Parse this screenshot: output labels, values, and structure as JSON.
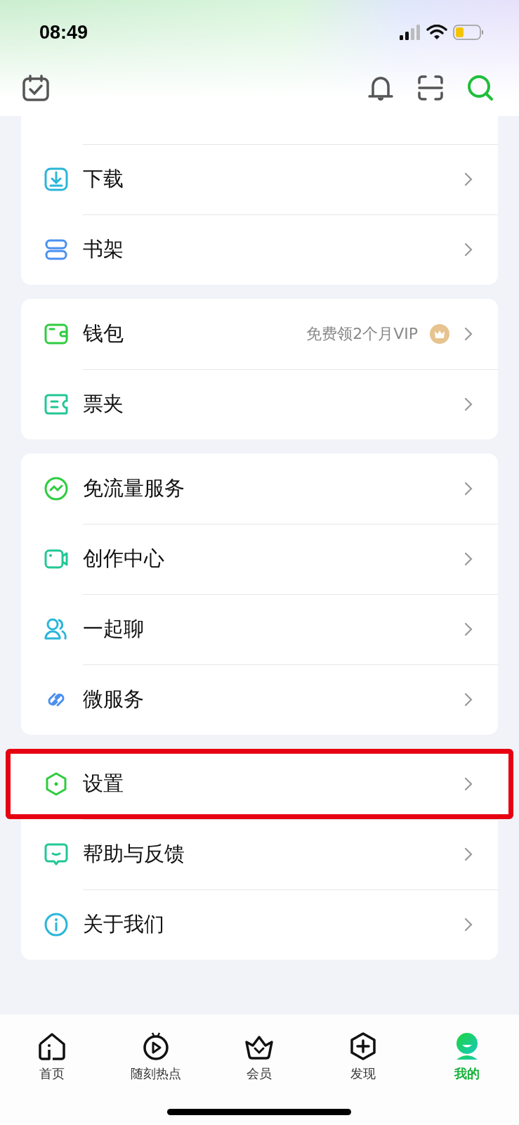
{
  "status_bar": {
    "time": "08:49"
  },
  "groups": [
    {
      "rows": [
        {
          "label": "下载",
          "highlighted": false
        },
        {
          "label": "书架",
          "highlighted": false
        }
      ]
    },
    {
      "rows": [
        {
          "label": "钱包",
          "note": "免费领2个月VIP",
          "highlighted": false
        },
        {
          "label": "票夹",
          "highlighted": false
        }
      ]
    },
    {
      "rows": [
        {
          "label": "免流量服务",
          "highlighted": false
        },
        {
          "label": "创作中心",
          "highlighted": false
        },
        {
          "label": "一起聊",
          "highlighted": false
        },
        {
          "label": "微服务",
          "highlighted": false
        }
      ]
    },
    {
      "rows": [
        {
          "label": "设置",
          "highlighted": true
        },
        {
          "label": "帮助与反馈",
          "highlighted": false
        },
        {
          "label": "关于我们",
          "highlighted": false
        }
      ]
    }
  ],
  "tab_bar": [
    {
      "label": "首页",
      "selected": false
    },
    {
      "label": "随刻热点",
      "selected": false
    },
    {
      "label": "会员",
      "selected": false
    },
    {
      "label": "发现",
      "selected": false
    },
    {
      "label": "我的",
      "selected": true
    }
  ]
}
